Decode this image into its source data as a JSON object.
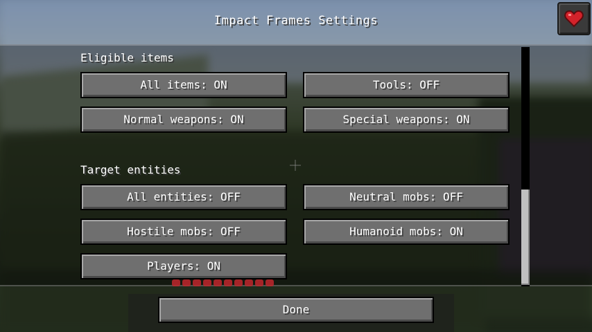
{
  "screen": {
    "title": "Impact Frames Settings"
  },
  "sections": {
    "eligible_items": {
      "label": "Eligible items",
      "buttons": [
        {
          "label": "All items: ON"
        },
        {
          "label": "Tools: OFF"
        },
        {
          "label": "Normal weapons: ON"
        },
        {
          "label": "Special weapons: ON"
        }
      ]
    },
    "target_entities": {
      "label": "Target entities",
      "buttons": [
        {
          "label": "All entities: OFF"
        },
        {
          "label": "Neutral mobs: OFF"
        },
        {
          "label": "Hostile mobs: OFF"
        },
        {
          "label": "Humanoid mobs: ON"
        },
        {
          "label": "Players: ON"
        }
      ]
    }
  },
  "footer": {
    "done_label": "Done"
  },
  "icons": {
    "corner_button": "heart-icon"
  },
  "colors": {
    "heart": "#d3222a",
    "button_face": "#6f6f6f",
    "text": "#ffffff"
  }
}
